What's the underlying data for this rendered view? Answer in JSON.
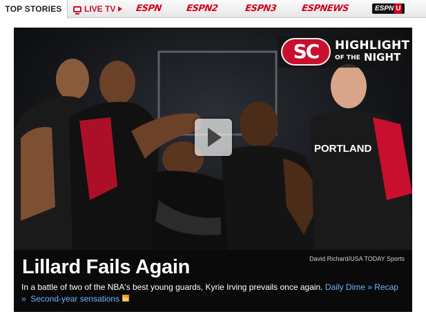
{
  "nav": {
    "top_stories": "TOP STORIES",
    "live_tv": "LIVE TV",
    "logos": {
      "espn": "ESPN",
      "espn2": "ESPN2",
      "espn3": "ESPN3",
      "espnews": "ESPNEWS",
      "espnu": "ESPN",
      "espnu_letter": "U"
    }
  },
  "hero": {
    "badge": {
      "sc": "SC",
      "line1": "HIGHLIGHT",
      "line2_small": "OF THE",
      "line2": "NIGHT"
    },
    "jersey_text": "PORTLAND",
    "credit": "David Richard/USA TODAY Sports",
    "headline": "Lillard Fails Again",
    "dek": "In a battle of two of the NBA's best young guards, Kyrie Irving prevails once again.",
    "links": {
      "daily_dime": "Daily Dime",
      "recap": "Recap",
      "second_year": "Second-year sensations"
    },
    "arrow": "»"
  },
  "colors": {
    "espn_red": "#d0021b",
    "link_blue": "#6fb3ff",
    "jersey_red": "#c8102e"
  }
}
